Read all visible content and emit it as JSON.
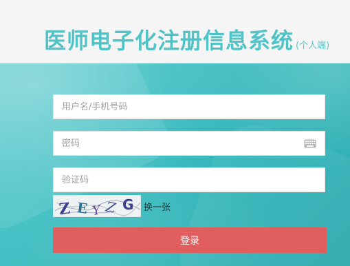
{
  "header": {
    "title": "医师电子化注册信息系统",
    "subtitle": "(个人端)"
  },
  "form": {
    "username_placeholder": "用户名/手机号码",
    "password_placeholder": "密码",
    "captcha_placeholder": "验证码",
    "refresh_captcha_label": "换一张",
    "login_button_label": "登录",
    "captcha_chars": [
      "Z",
      "E",
      "Y",
      "Z",
      "G"
    ]
  },
  "colors": {
    "title": "#4fc3c6",
    "panel": "#3bbdc1",
    "button": "#e05e5e"
  },
  "icons": {
    "password_field": "keyboard-icon"
  }
}
